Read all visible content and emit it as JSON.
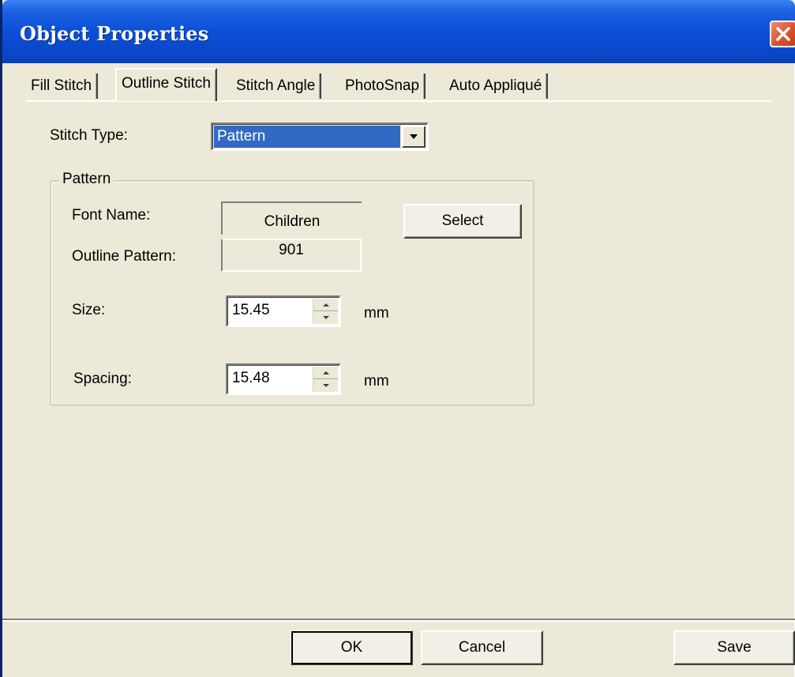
{
  "window": {
    "title": "Object Properties"
  },
  "tabs": [
    {
      "label": "Fill Stitch",
      "active": false
    },
    {
      "label": "Outline Stitch",
      "active": true
    },
    {
      "label": "Stitch Angle",
      "active": false
    },
    {
      "label": "PhotoSnap",
      "active": false
    },
    {
      "label": "Auto Appliqué",
      "active": false
    }
  ],
  "stitch_type": {
    "label": "Stitch Type:",
    "value": "Pattern"
  },
  "pattern_group": {
    "legend": "Pattern",
    "font_name_label": "Font Name:",
    "font_name_value": "Children",
    "outline_pattern_label": "Outline Pattern:",
    "outline_pattern_value": "901",
    "select_button": "Select",
    "size_label": "Size:",
    "size_value": "15.45",
    "size_unit": "mm",
    "spacing_label": "Spacing:",
    "spacing_value": "15.48",
    "spacing_unit": "mm"
  },
  "footer": {
    "ok": "OK",
    "cancel": "Cancel",
    "save": "Save"
  },
  "colors": {
    "titlebar": "#0b4fd8",
    "dialog_bg": "#ece9d8",
    "selection": "#316ac5",
    "close_button": "#d8512e"
  },
  "icons": {
    "close": "close-icon",
    "dropdown": "chevron-down-icon",
    "spin_up": "spin-up-icon",
    "spin_down": "spin-down-icon"
  }
}
